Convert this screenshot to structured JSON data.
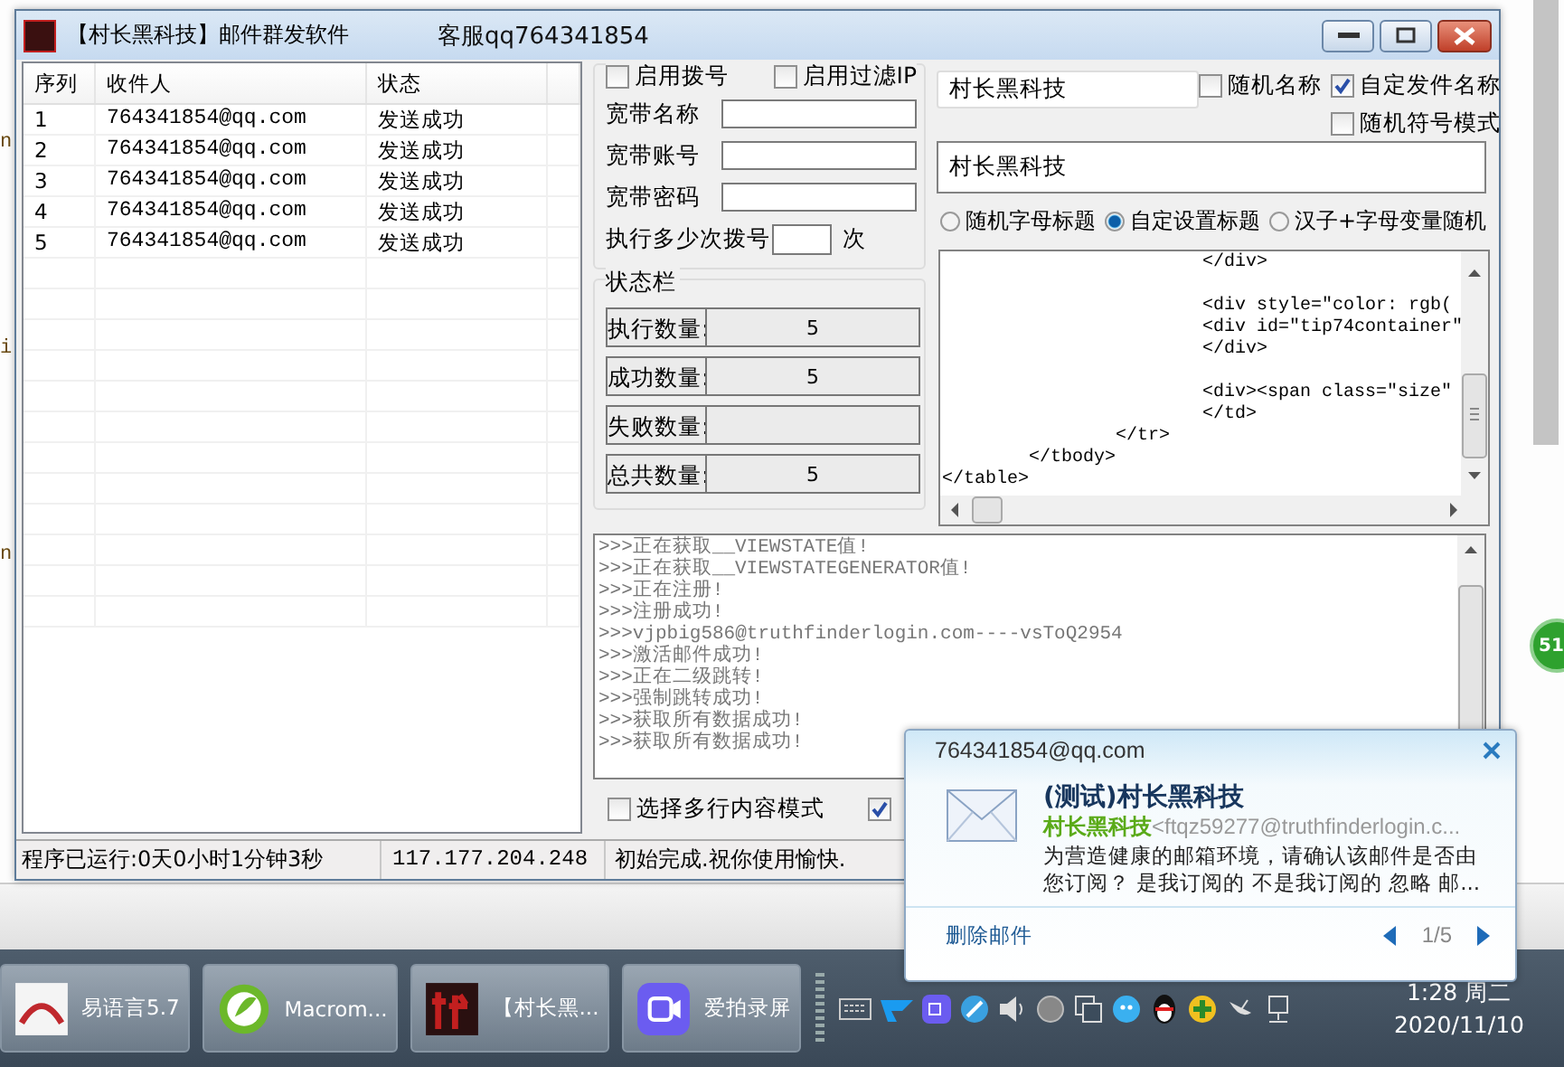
{
  "window": {
    "title": "【村长黑科技】邮件群发软件",
    "support": "客服qq764341854"
  },
  "recipients": {
    "columns": [
      "序列",
      "收件人",
      "状态"
    ],
    "rows": [
      {
        "index": "1",
        "email": "764341854@qq.com",
        "status": "发送成功"
      },
      {
        "index": "2",
        "email": "764341854@qq.com",
        "status": "发送成功"
      },
      {
        "index": "3",
        "email": "764341854@qq.com",
        "status": "发送成功"
      },
      {
        "index": "4",
        "email": "764341854@qq.com",
        "status": "发送成功"
      },
      {
        "index": "5",
        "email": "764341854@qq.com",
        "status": "发送成功"
      }
    ]
  },
  "dial_options": [
    {
      "label": "启用拨号",
      "checked": false
    },
    {
      "label": "启用过滤IP",
      "checked": false
    }
  ],
  "broadband_fields": [
    {
      "label": "宽带名称"
    },
    {
      "label": "宽带账号"
    },
    {
      "label": "宽带密码"
    }
  ],
  "dial_count": {
    "label": "执行多少次拨号",
    "unit": "次"
  },
  "status_group": {
    "title": "状态栏",
    "stats": [
      {
        "label": "执行数量:",
        "value": "5"
      },
      {
        "label": "成功数量:",
        "value": "5"
      },
      {
        "label": "失败数量:"
      },
      {
        "label": "总共数量:",
        "value": "5"
      }
    ]
  },
  "sender_name": {
    "value": "村长黑科技"
  },
  "sender_options": [
    {
      "label": "随机名称",
      "checked": false
    },
    {
      "label": "自定发件名称",
      "checked": true
    },
    {
      "label": "随机符号模式",
      "checked": false
    }
  ],
  "subject": {
    "value": "村长黑科技"
  },
  "subject_modes": [
    {
      "label": "随机字母标题",
      "selected": false
    },
    {
      "label": "自定设置标题",
      "selected": true
    },
    {
      "label": "汉子+字母变量随机",
      "selected": false
    }
  ],
  "body_html": "                        </div>\n\n                        <div style=\"color: rgb(\n                        <div id=\"tip74container\"\n                        </div>\n\n                        <div><span class=\"size\"\n                        </td>\n                </tr>\n        </tbody>\n</table>",
  "log_lines": [
    ">>>正在获取__VIEWSTATE值!",
    ">>>正在获取__VIEWSTATEGENERATOR值!",
    ">>>正在注册!",
    ">>>注册成功!",
    ">>>vjpbig586@truthfinderlogin.com----vsToQ2954",
    ">>>激活邮件成功!",
    ">>>正在二级跳转!",
    ">>>强制跳转成功!",
    ">>>获取所有数据成功!",
    ">>>获取所有数据成功!"
  ],
  "bottom_options": [
    {
      "label": "选择多行内容模式",
      "checked": false
    },
    {
      "checked": true
    }
  ],
  "status_bar": [
    "程序已运行:0天0小时1分钟3秒",
    "117.177.204.248",
    "初始完成.祝你使用愉快."
  ],
  "notification": {
    "account": "764341854@qq.com",
    "subject": "(测试)村长黑科技",
    "sender_name": "村长黑科技",
    "sender_address": "<ftqz59277@truthfinderlogin.c...",
    "preview": " 为营造健康的邮箱环境，请确认该邮件是否由您订阅？ 是我订阅的 不是我订阅的 忽略 邮...",
    "delete_link": "删除邮件",
    "pager": "1/5"
  },
  "taskbar": {
    "buttons": [
      {
        "label": "易语言5.7"
      },
      {
        "label": "Macrom..."
      },
      {
        "label": "【村长黑..."
      },
      {
        "label": "爱拍录屏"
      }
    ],
    "clock": {
      "time": "1:28 周二",
      "date": "2020/11/10"
    }
  },
  "desktop": {
    "badge": "51",
    "edge_text": [
      "n",
      "i",
      "n"
    ]
  }
}
